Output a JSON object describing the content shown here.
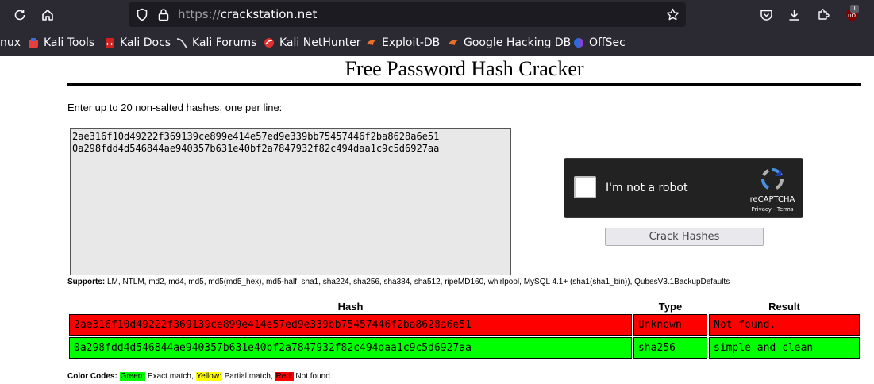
{
  "browser": {
    "url_protocol": "https://",
    "url_host": "crackstation.net",
    "extension_badge": "1",
    "icons": [
      "reload-icon",
      "home-icon",
      "shield-icon",
      "lock-icon",
      "star-icon",
      "pocket-icon",
      "download-icon",
      "extensions-icon",
      "ublock-icon"
    ]
  },
  "bookmarks": [
    {
      "label": "nux",
      "icon": "kali-icon"
    },
    {
      "label": "Kali Tools",
      "icon": "kali-tools-icon"
    },
    {
      "label": "Kali Docs",
      "icon": "kali-docs-icon"
    },
    {
      "label": "Kali Forums",
      "icon": "kali-forums-icon"
    },
    {
      "label": "Kali NetHunter",
      "icon": "nethunter-icon"
    },
    {
      "label": "Exploit-DB",
      "icon": "exploit-db-icon"
    },
    {
      "label": "Google Hacking DB",
      "icon": "ghdb-icon"
    },
    {
      "label": "OffSec",
      "icon": "offsec-icon"
    }
  ],
  "page": {
    "title": "Free Password Hash Cracker",
    "instructions": "Enter up to 20 non-salted hashes, one per line:",
    "textarea_value": "2ae316f10d49222f369139ce899e414e57ed9e339bb75457446f2ba8628a6e51\n0a298fdd4d546844ae940357b631e40bf2a7847932f82c494daa1c9c5d6927aa",
    "captcha": {
      "label": "I'm not a robot",
      "brand": "reCAPTCHA",
      "links": "Privacy - Terms"
    },
    "crack_button": "Crack Hashes",
    "supports_label": "Supports:",
    "supports_text": " LM, NTLM, md2, md4, md5, md5(md5_hex), md5-half, sha1, sha224, sha256, sha384, sha512, ripeMD160, whirlpool, MySQL 4.1+ (sha1(sha1_bin)), QubesV3.1BackupDefaults",
    "results": {
      "headers": [
        "Hash",
        "Type",
        "Result"
      ],
      "rows": [
        {
          "hash": "2ae316f10d49222f369139ce899e414e57ed9e339bb75457446f2ba8628a6e51",
          "type": "Unknown",
          "result": "Not found.",
          "status": "red"
        },
        {
          "hash": "0a298fdd4d546844ae940357b631e40bf2a7847932f82c494daa1c9c5d6927aa",
          "type": "sha256",
          "result": "simple and clean",
          "status": "green"
        }
      ]
    },
    "color_codes": {
      "label": "Color Codes:",
      "green": "Green:",
      "green_desc": " Exact match, ",
      "yellow": "Yellow:",
      "yellow_desc": " Partial match, ",
      "red": "Red:",
      "red_desc": " Not found."
    }
  },
  "colors": {
    "toolbar_bg": "#2b2a33",
    "not_found": "#ff0000",
    "exact_match": "#00ff00",
    "partial_match": "#ffff00"
  }
}
